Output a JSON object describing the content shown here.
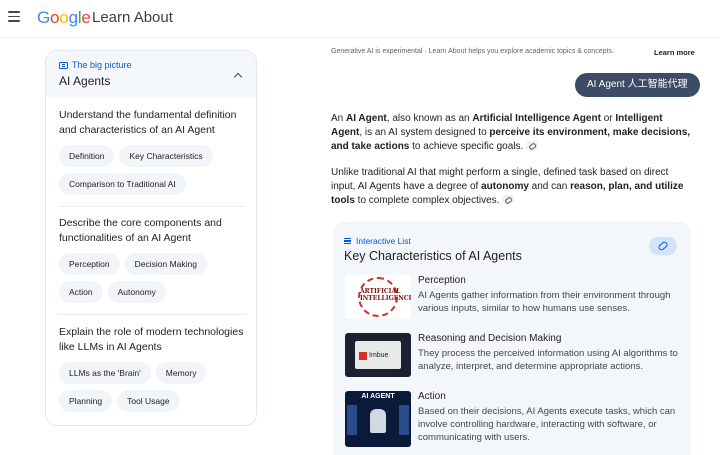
{
  "header": {
    "logo": [
      "G",
      "o",
      "o",
      "g",
      "l",
      "e"
    ],
    "product": "Learn About"
  },
  "sidebar": {
    "eyebrow": "The big picture",
    "title": "AI Agents",
    "sections": [
      {
        "title": "Understand the fundamental definition and characteristics of an AI Agent",
        "chips": [
          "Definition",
          "Key Characteristics",
          "Comparison to Traditional AI"
        ]
      },
      {
        "title": "Describe the core components and functionalities of an AI Agent",
        "chips": [
          "Perception",
          "Decision Making",
          "Action",
          "Autonomy"
        ]
      },
      {
        "title": "Explain the role of modern technologies like LLMs in AI Agents",
        "chips": [
          "LLMs as the 'Brain'",
          "Memory",
          "Planning",
          "Tool Usage"
        ]
      }
    ]
  },
  "main": {
    "notice": "Generative AI is experimental · Learn About helps you explore academic topics & concepts.",
    "learn_more": "Learn more",
    "query": "AI Agent 人工智能代理",
    "para1": {
      "t1": "An ",
      "b1": "AI Agent",
      "t2": ", also known as an ",
      "b2": "Artificial Intelligence Agent",
      "t3": " or ",
      "b3": "Intelligent Agent",
      "t4": ", is an AI system designed to ",
      "b4": "perceive its environment, make decisions, and take actions",
      "t5": " to achieve specific goals."
    },
    "para2": {
      "t1": "Unlike traditional AI that might perform a single, defined task based on direct input, AI Agents have a degree of ",
      "b1": "autonomy",
      "t2": " and can ",
      "b2": "reason, plan, and utilize tools",
      "t3": " to complete complex objectives."
    },
    "list": {
      "eyebrow": "Interactive List",
      "title": "Key Characteristics of AI Agents",
      "items": [
        {
          "title": "Perception",
          "desc": "AI Agents gather information from their environment through various inputs, similar to how humans use senses.",
          "thumb_text": "ARTIFICIAL INTELLIGENCE"
        },
        {
          "title": "Reasoning and Decision Making",
          "desc": "They process the perceived information using AI algorithms to analyze, interpret, and determine appropriate actions.",
          "thumb_text": "Imbue"
        },
        {
          "title": "Action",
          "desc": "Based on their decisions, AI Agents execute tasks, which can involve controlling hardware, interacting with software, or communicating with users.",
          "thumb_text": "AI AGENT"
        }
      ]
    }
  }
}
